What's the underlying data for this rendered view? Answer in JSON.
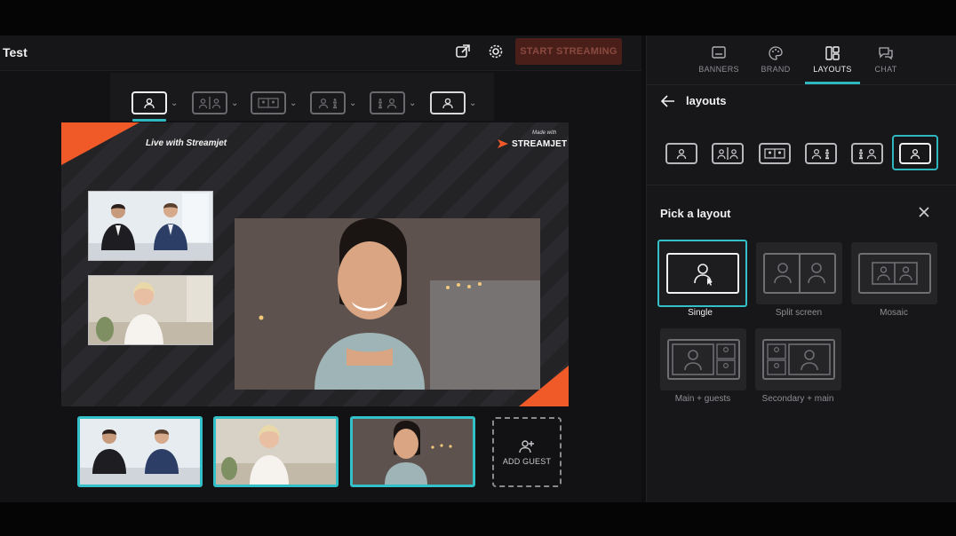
{
  "app": {
    "title": "Test",
    "start_button": "START STREAMING",
    "accent": "#2fb7c0",
    "brand_accent": "#f05a28"
  },
  "header_icons": [
    "external-link-icon",
    "gear-icon"
  ],
  "layout_bar": {
    "items": [
      "single",
      "split-screen",
      "mosaic",
      "main-guests",
      "secondary-main",
      "single-alt"
    ]
  },
  "stage": {
    "live_text": "Live with Streamjet",
    "made_with": "Made with",
    "brand_name": "STREAMJET"
  },
  "add_guest": {
    "label": "ADD GUEST"
  },
  "panel": {
    "tabs": [
      {
        "label": "BANNERS",
        "icon": "banner-icon"
      },
      {
        "label": "BRAND",
        "icon": "palette-icon"
      },
      {
        "label": "LAYOUTS",
        "icon": "layouts-icon"
      },
      {
        "label": "CHAT",
        "icon": "chat-icon"
      }
    ],
    "active_tab": "LAYOUTS",
    "back_label": "layouts",
    "pick_title": "Pick a layout",
    "options": [
      {
        "label": "Single"
      },
      {
        "label": "Split screen"
      },
      {
        "label": "Mosaic"
      },
      {
        "label": "Main + guests"
      },
      {
        "label": "Secondary + main"
      }
    ],
    "selected_option": "Single"
  }
}
